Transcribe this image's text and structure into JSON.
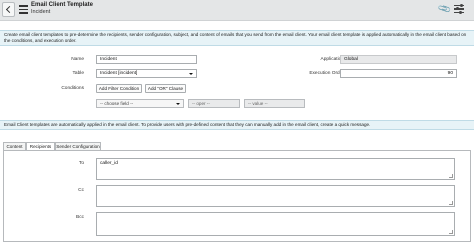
{
  "header": {
    "title": "Email Client Template",
    "subtitle": "Incident"
  },
  "info_top": "Create email client templates to pre-determine the recipients, sender configuration, subject, and content of emails that you send from the email client. Your email client template is applied automatically in the email client based on the conditions, and execution order.",
  "form": {
    "name_label": "Name",
    "name_value": "Incident",
    "table_label": "Table",
    "table_value": "Incident [incident]",
    "conditions_label": "Conditions",
    "add_filter_label": "Add Filter Condition",
    "add_or_label": "Add \"OR\" Clause",
    "choose_field": "-- choose field --",
    "oper": "-- oper --",
    "value": "-- value --",
    "application_label": "Application",
    "application_value": "Global",
    "execution_order_label": "Execution Order",
    "execution_order_value": "90"
  },
  "info_bottom": "Email Client templates are automatically applied in the email client. To provide users with pre-defined content that they can manually add in the email client, create a quick message.",
  "tabs": [
    {
      "label": "Content"
    },
    {
      "label": "Recipients"
    },
    {
      "label": "Sender Configuration"
    }
  ],
  "recipients": {
    "to_label": "To",
    "to_value": "caller_id",
    "cc_label": "Cc",
    "cc_value": "",
    "bcc_label": "Bcc",
    "bcc_value": ""
  },
  "icons": [
    "back-icon",
    "menu-icon",
    "paperclip-icon",
    "settings-icon"
  ]
}
